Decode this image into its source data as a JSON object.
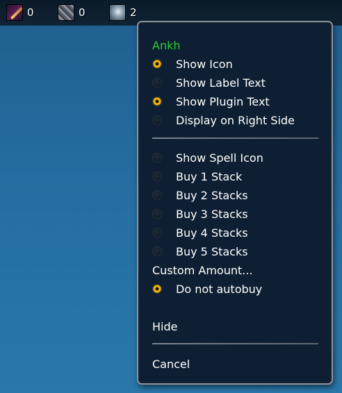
{
  "topbar": {
    "plugins": [
      {
        "icon": "feather-icon",
        "value": "0"
      },
      {
        "icon": "rune-icon",
        "value": "0"
      },
      {
        "icon": "ankh-icon",
        "value": "2"
      }
    ]
  },
  "menu": {
    "title": "Ankh",
    "display_options": [
      {
        "label": "Show Icon",
        "checked": true
      },
      {
        "label": "Show Label Text",
        "checked": false
      },
      {
        "label": "Show Plugin Text",
        "checked": true
      },
      {
        "label": "Display on Right Side",
        "checked": false
      }
    ],
    "buy_options": [
      {
        "label": "Show Spell Icon",
        "checked": false
      },
      {
        "label": "Buy 1 Stack",
        "checked": false
      },
      {
        "label": "Buy 2 Stacks",
        "checked": false
      },
      {
        "label": "Buy 3 Stacks",
        "checked": false
      },
      {
        "label": "Buy 4 Stacks",
        "checked": false
      },
      {
        "label": "Buy 5 Stacks",
        "checked": false
      }
    ],
    "custom_amount": "Custom Amount...",
    "do_not_autobuy": {
      "label": "Do not autobuy",
      "checked": true
    },
    "hide": "Hide",
    "cancel": "Cancel"
  },
  "colors": {
    "title_green": "#2ecb32",
    "radio_checked": "#f2b90c",
    "menu_bg": "#0f1f33",
    "desktop_blue": "#246da0"
  }
}
